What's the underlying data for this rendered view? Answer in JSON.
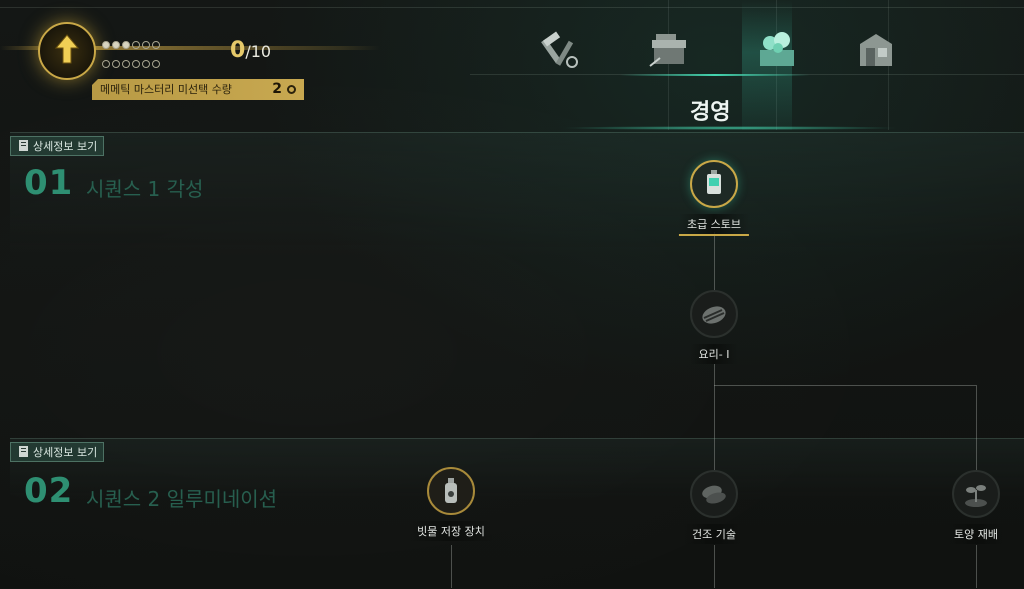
{
  "mastery": {
    "count": "0",
    "total": "/10",
    "dots_filled": 3,
    "dots_total": 12,
    "unselected_label": "메메틱 마스터리 미선택 수량",
    "unselected_count": "2"
  },
  "tabs": [
    {
      "name": "tools",
      "icon": "hammer-wrench-icon",
      "active": false
    },
    {
      "name": "workbench",
      "icon": "workbench-icon",
      "active": false
    },
    {
      "name": "management",
      "icon": "crate-plant-icon",
      "active": true
    },
    {
      "name": "housing",
      "icon": "cabinet-icon",
      "active": false
    }
  ],
  "category_title": "경영",
  "sections": [
    {
      "detail_label": "상세정보 보기",
      "number": "01",
      "title": "시퀀스 1 각성"
    },
    {
      "detail_label": "상세정보 보기",
      "number": "02",
      "title": "시퀀스 2 일루미네이션"
    }
  ],
  "nodes": [
    {
      "label": "초급 스토브",
      "icon": "stove-icon",
      "state": "active"
    },
    {
      "label": "요리- I",
      "icon": "steak-icon",
      "state": "locked"
    },
    {
      "label": "빗물 저장 장치",
      "icon": "water-bottle-icon",
      "state": "gold"
    },
    {
      "label": "건조 기술",
      "icon": "dried-meat-icon",
      "state": "locked"
    },
    {
      "label": "토양 재배",
      "icon": "sprout-icon",
      "state": "locked"
    }
  ],
  "colors": {
    "accent": "#44d6b0",
    "gold": "#c9a847",
    "section_number": "#2e8f72"
  }
}
